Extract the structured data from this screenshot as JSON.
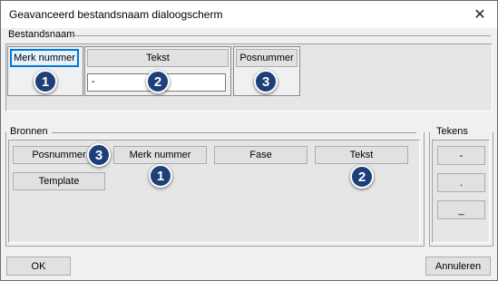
{
  "window": {
    "title": "Geavanceerd bestandsnaam dialoogscherm",
    "close_glyph": "✕"
  },
  "bestandsnaam": {
    "label": "Bestandsnaam",
    "segments": [
      {
        "button": "Merk nummer",
        "badge": "1"
      },
      {
        "button": "Tekst",
        "value": "-",
        "badge": "2"
      },
      {
        "button": "Posnummer",
        "badge": "3"
      }
    ]
  },
  "bronnen": {
    "label": "Bronnen",
    "buttons": [
      "Posnummer",
      "Merk nummer",
      "Fase",
      "Tekst",
      "Template"
    ],
    "badges": [
      "3",
      "1",
      "2"
    ]
  },
  "tekens": {
    "label": "Tekens",
    "buttons": [
      "-",
      ".",
      "_"
    ]
  },
  "footer": {
    "ok": "OK",
    "cancel": "Annuleren"
  },
  "colors": {
    "badge": "#1f3f7a",
    "focus": "#0078d7"
  }
}
